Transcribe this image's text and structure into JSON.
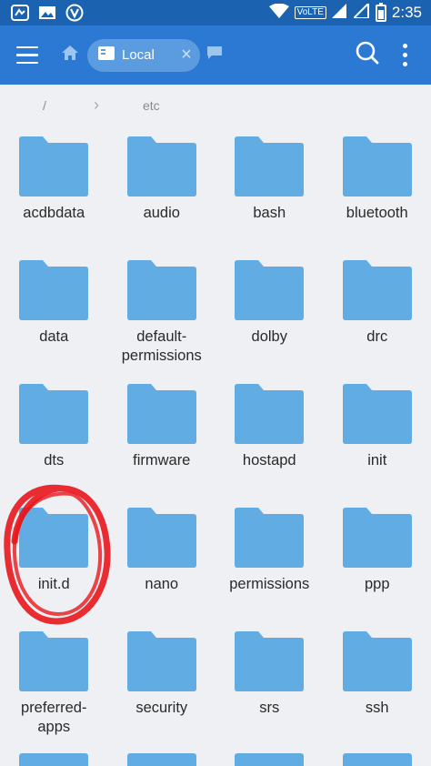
{
  "status_bar": {
    "time": "2:35",
    "network": "VoLTE"
  },
  "toolbar": {
    "tab_label": "Local",
    "icons": [
      "menu-icon",
      "home-icon",
      "phone-storage-icon",
      "close-icon",
      "chat-icon",
      "search-icon",
      "more-vert-icon"
    ]
  },
  "breadcrumb": {
    "root": "/",
    "current": "etc"
  },
  "folders": [
    "acdbdata",
    "audio",
    "bash",
    "bluetooth",
    "data",
    "default-\npermissions",
    "dolby",
    "drc",
    "dts",
    "firmware",
    "hostapd",
    "init",
    "init.d",
    "nano",
    "permissions",
    "ppp",
    "preferred-\napps",
    "security",
    "srs",
    "ssh"
  ],
  "colors": {
    "status_bar": "#1b63b0",
    "toolbar": "#2b79d2",
    "folder": "#62ace4",
    "annotation": "#e8161c"
  }
}
